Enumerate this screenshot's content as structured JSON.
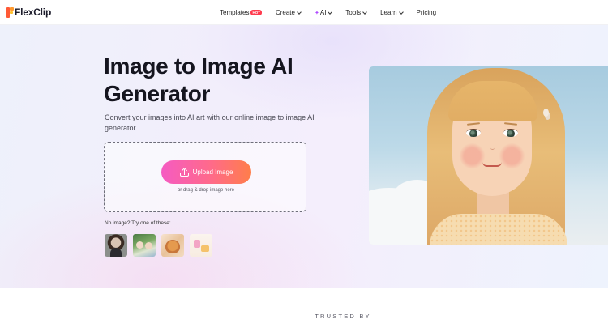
{
  "header": {
    "logo": "FlexClip",
    "nav": [
      {
        "label": "Templates",
        "badge": "HOT",
        "dropdown": false
      },
      {
        "label": "Create",
        "dropdown": true
      },
      {
        "label": "AI",
        "icon": "sparkle-icon",
        "dropdown": true
      },
      {
        "label": "Tools",
        "dropdown": true
      },
      {
        "label": "Learn",
        "dropdown": true
      },
      {
        "label": "Pricing",
        "dropdown": false
      }
    ]
  },
  "hero": {
    "title": "Image to Image AI Generator",
    "subtitle": "Convert your images into AI art with our online image to image AI generator.",
    "upload_label": "Upload Image",
    "drag_text": "or drag & drop image here",
    "try_text": "No image? Try one of these:",
    "samples": [
      "sample-portrait-woman",
      "sample-group-photo",
      "sample-cat",
      "sample-objects"
    ]
  },
  "trusted": "TRUSTED BY",
  "colors": {
    "accent_start": "#f55bc2",
    "accent_end": "#ff7e4a",
    "hot_badge": "#ff3b4e"
  }
}
